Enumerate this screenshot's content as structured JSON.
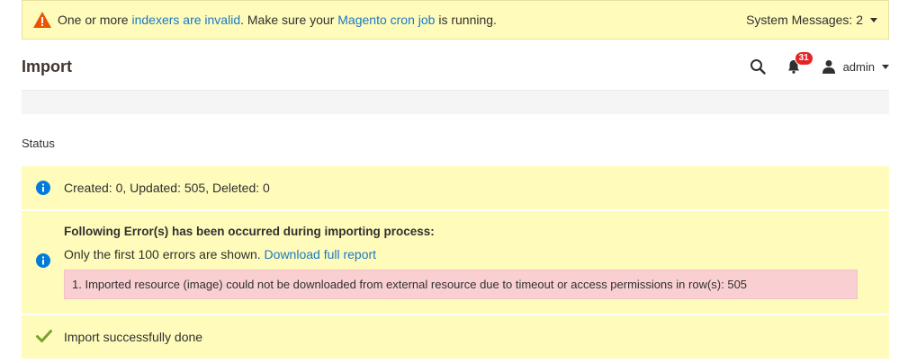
{
  "system_bar": {
    "text_before": "One or more ",
    "indexers_link": "indexers are invalid",
    "text_middle": ". Make sure your ",
    "cron_link": "Magento cron job",
    "text_after": " is running.",
    "messages_toggle": "System Messages: 2",
    "warning_color": "#eb5202"
  },
  "header": {
    "title": "Import",
    "notifications_count": "31",
    "user_name": "admin"
  },
  "status_label": "Status",
  "summary_message": "Created: 0, Updated: 505, Deleted: 0",
  "errors": {
    "title": "Following Error(s) has been occurred during importing process:",
    "note_text": "Only the first 100 errors are shown. ",
    "download_link": "Download full report",
    "items": [
      "1. Imported resource (image) could not be downloaded from external resource due to timeout or access permissions in row(s): 505"
    ]
  },
  "success_message": "Import successfully done",
  "colors": {
    "info_icon": "#007bdb",
    "success_icon": "#79a22e",
    "error_bg": "#f9cfd2",
    "notice_bg": "#fffbbb"
  }
}
